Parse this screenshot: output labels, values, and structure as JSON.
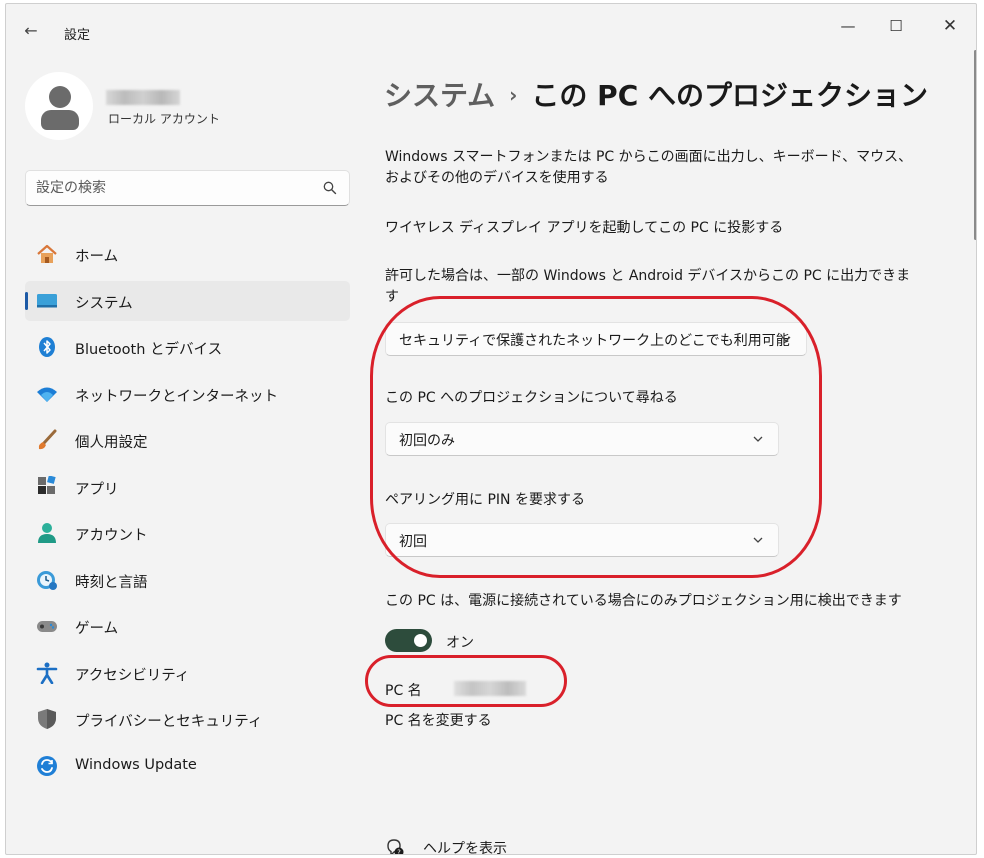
{
  "window": {
    "title": "設定",
    "controls": {
      "minimize": "—",
      "maximize": "☐",
      "close": "✕"
    }
  },
  "profile": {
    "account_type": "ローカル アカウント"
  },
  "search": {
    "placeholder": "設定の検索"
  },
  "sidebar": {
    "items": [
      {
        "label": "ホーム",
        "icon": "home-icon"
      },
      {
        "label": "システム",
        "icon": "system-icon",
        "active": true
      },
      {
        "label": "Bluetooth とデバイス",
        "icon": "bluetooth-icon"
      },
      {
        "label": "ネットワークとインターネット",
        "icon": "wifi-icon"
      },
      {
        "label": "個人用設定",
        "icon": "brush-icon"
      },
      {
        "label": "アプリ",
        "icon": "apps-icon"
      },
      {
        "label": "アカウント",
        "icon": "account-icon"
      },
      {
        "label": "時刻と言語",
        "icon": "clock-globe-icon"
      },
      {
        "label": "ゲーム",
        "icon": "gamepad-icon"
      },
      {
        "label": "アクセシビリティ",
        "icon": "accessibility-icon"
      },
      {
        "label": "プライバシーとセキュリティ",
        "icon": "shield-icon"
      },
      {
        "label": "Windows Update",
        "icon": "update-icon"
      }
    ]
  },
  "main": {
    "breadcrumb": {
      "parent": "システム",
      "separator": "›",
      "current": "この PC へのプロジェクション"
    },
    "description1": "Windows スマートフォンまたは PC からこの画面に出力し、キーボード、マウス、およびその他のデバイスを使用する",
    "description2": "ワイヤレス ディスプレイ アプリを起動してこの PC に投影する",
    "description3": "許可した場合は、一部の Windows と Android デバイスからこの PC に出力できます",
    "availability_dropdown": {
      "value": "セキュリティで保護されたネットワーク上のどこでも利用可能"
    },
    "ask_label": "この PC へのプロジェクションについて尋ねる",
    "ask_dropdown": {
      "value": "初回のみ"
    },
    "pin_label": "ペアリング用に PIN を要求する",
    "pin_dropdown": {
      "value": "初回"
    },
    "power_label": "この PC は、電源に接続されている場合にのみプロジェクション用に検出できます",
    "power_toggle": {
      "state": "オン",
      "on": true
    },
    "pc_name_label": "PC 名",
    "rename_link": "PC 名を変更する",
    "help_link": "ヘルプを表示"
  },
  "colors": {
    "accent": "#1d5aa6",
    "toggle_on": "#2d4c3c",
    "annotation": "#d9202a",
    "window_bg": "#f3f3f3"
  }
}
